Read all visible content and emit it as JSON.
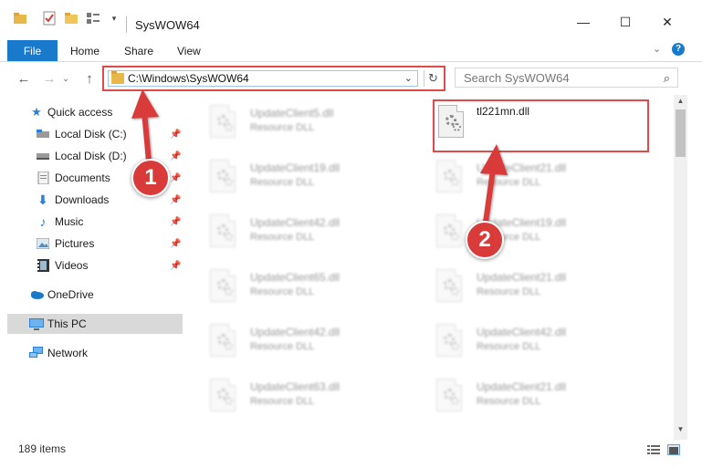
{
  "window": {
    "title": "SysWOW64",
    "minimize": "—",
    "maximize": "☐",
    "close": "✕"
  },
  "ribbon": {
    "tabs": [
      {
        "label": "File"
      },
      {
        "label": "Home"
      },
      {
        "label": "Share"
      },
      {
        "label": "View"
      }
    ]
  },
  "address_bar": {
    "path": "C:\\Windows\\SysWOW64"
  },
  "search": {
    "placeholder": "Search SysWOW64"
  },
  "sidebar": {
    "items": [
      {
        "label": "Quick access",
        "icon": "star-icon",
        "pinned": false
      },
      {
        "label": "Local Disk (C:)",
        "icon": "disk-icon",
        "pinned": true
      },
      {
        "label": "Local Disk (D:)",
        "icon": "disk-icon",
        "pinned": true
      },
      {
        "label": "Documents",
        "icon": "documents-icon",
        "pinned": true
      },
      {
        "label": "Downloads",
        "icon": "download-icon",
        "pinned": true
      },
      {
        "label": "Music",
        "icon": "music-icon",
        "pinned": true
      },
      {
        "label": "Pictures",
        "icon": "pictures-icon",
        "pinned": true
      },
      {
        "label": "Videos",
        "icon": "videos-icon",
        "pinned": true
      },
      {
        "label": "OneDrive",
        "icon": "cloud-icon",
        "pinned": false
      },
      {
        "label": "This PC",
        "icon": "computer-icon",
        "pinned": false,
        "selected": true
      },
      {
        "label": "Network",
        "icon": "network-icon",
        "pinned": false
      }
    ]
  },
  "files": {
    "highlighted": {
      "name": "tl221mn.dll",
      "type": ""
    },
    "left_column": [
      {
        "name": "UpdateClient5.dll",
        "type": "Resource DLL"
      },
      {
        "name": "UpdateClient19.dll",
        "type": "Resource DLL"
      },
      {
        "name": "UpdateClient42.dll",
        "type": "Resource DLL"
      },
      {
        "name": "UpdateClient65.dll",
        "type": "Resource DLL"
      },
      {
        "name": "UpdateClient42.dll",
        "type": "Resource DLL"
      },
      {
        "name": "UpdateClient63.dll",
        "type": "Resource DLL"
      }
    ],
    "right_column": [
      {
        "name": "UpdateClient21.dll",
        "type": "Resource DLL"
      },
      {
        "name": "UpdateClient19.dll",
        "type": "Resource DLL"
      },
      {
        "name": "UpdateClient21.dll",
        "type": "Resource DLL"
      },
      {
        "name": "UpdateClient42.dll",
        "type": "Resource DLL"
      },
      {
        "name": "UpdateClient21.dll",
        "type": "Resource DLL"
      }
    ]
  },
  "status_bar": {
    "item_count": "189 items"
  },
  "annotations": {
    "step1": "1",
    "step2": "2",
    "color": "#d93a3a"
  }
}
